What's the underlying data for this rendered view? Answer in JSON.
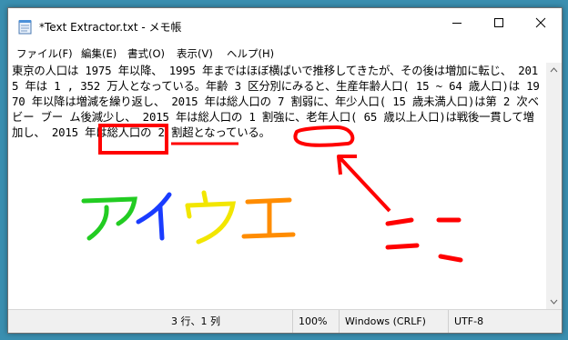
{
  "window": {
    "title": "*Text Extractor.txt - メモ帳",
    "controls": {
      "minimize": "—",
      "maximize": "☐",
      "close": "✕"
    }
  },
  "menu": [
    "ファイル(F)",
    "編集(E)",
    "書式(O)",
    "表示(V)",
    "ヘルプ(H)"
  ],
  "editor": {
    "text": "東京の人口は 1975 年以降、 1995 年まではほぼ横ばいで推移してきたが、その後は増加に転じ、 2015 年は 1 , 352 万人となっている。年齢 3 区分別にみると、生産年齢人口( 15 ~ 64 歳人口)は 1970 年以降は増減を繰り返し、 2015 年は総人口の 7 割弱に、年少人口( 15 歳未満人口)は第 2 次ベビー ブー ム後減少し、 2015 年は総人口の 1 割強に、老年人口( 65 歳以上人口)は戦後一貫して増加し、 2015 年は総人口の 2 割超となっている。"
  },
  "annotations": {
    "handwriting_left": "アイウエ",
    "handwriting_right": "ここ",
    "colors": {
      "red": "#ff0000",
      "blue": "#1a3cff",
      "green": "#22cc22",
      "yellow": "#f2e600",
      "orange": "#ff8c00"
    }
  },
  "status": {
    "position": "3 行、1 列",
    "zoom": "100%",
    "line_ending": "Windows (CRLF)",
    "encoding": "UTF-8"
  }
}
